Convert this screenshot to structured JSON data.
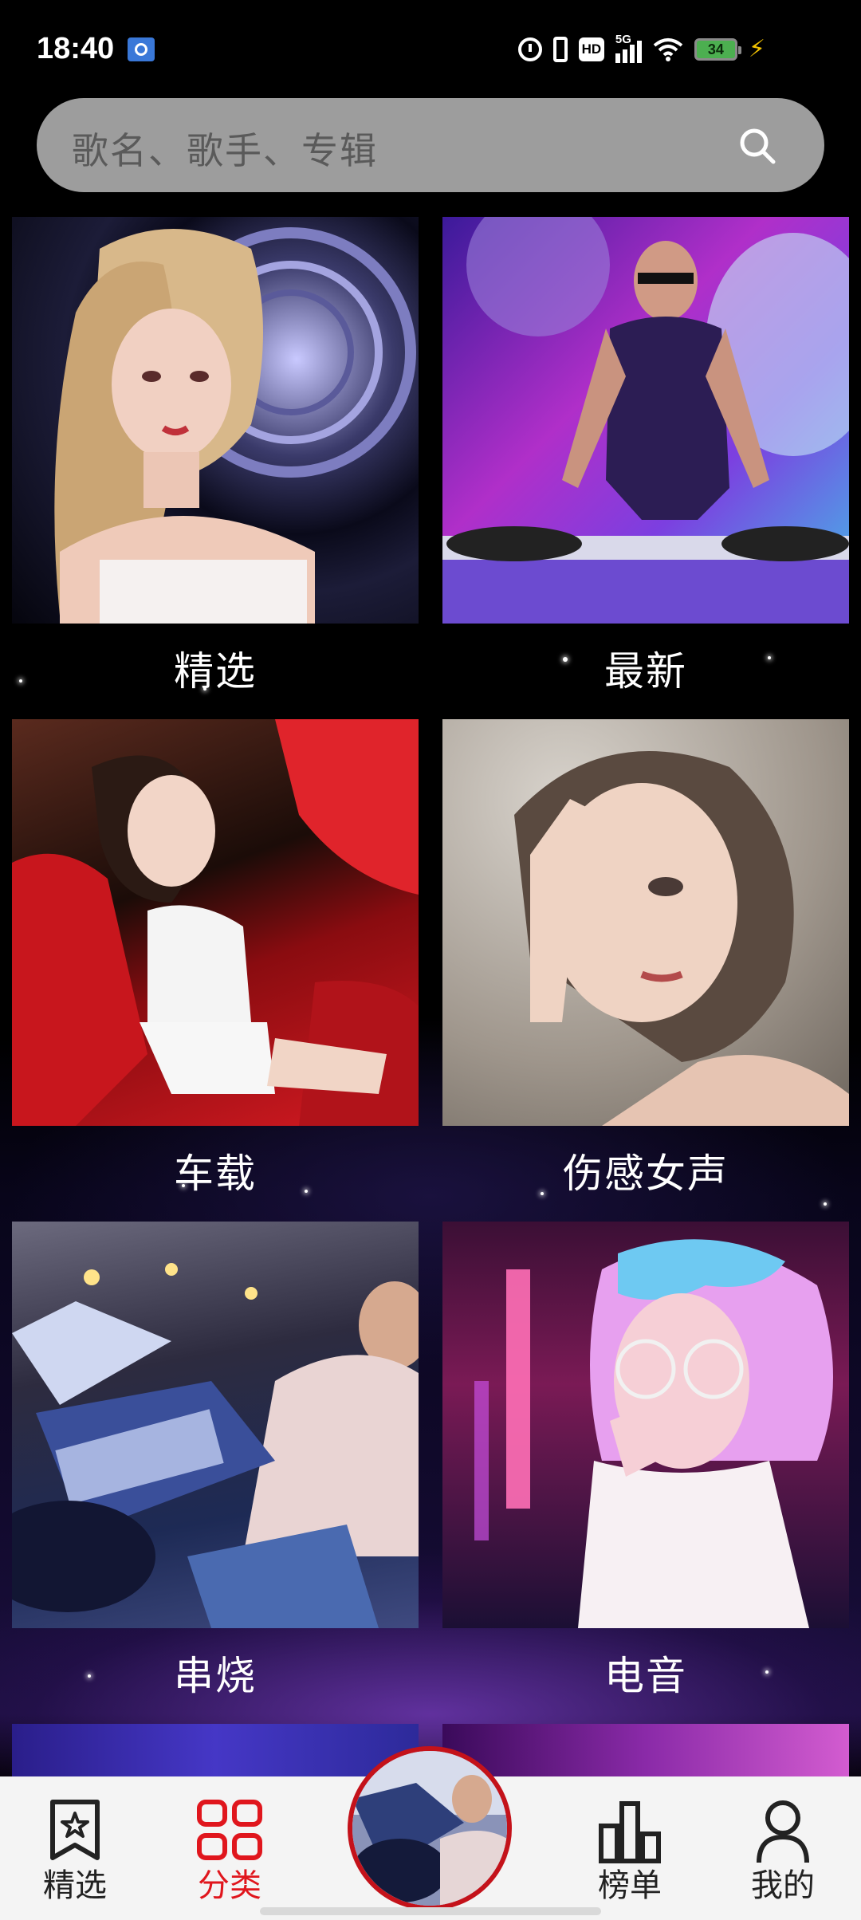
{
  "status_bar": {
    "time": "18:40",
    "network": "5G",
    "hd_label": "HD",
    "battery": "34"
  },
  "search": {
    "placeholder": "歌名、歌手、专辑"
  },
  "categories": [
    {
      "label": "精选",
      "image": "blonde-girl-portrait"
    },
    {
      "label": "最新",
      "image": "dj-woman-turntables"
    },
    {
      "label": "车载",
      "image": "woman-in-red-car"
    },
    {
      "label": "伤感女声",
      "image": "crying-girl-illustration"
    },
    {
      "label": "串烧",
      "image": "dj-at-mixer"
    },
    {
      "label": "电音",
      "image": "neon-girl-glasses"
    }
  ],
  "bottom_nav": {
    "items": [
      {
        "label": "精选",
        "icon": "star-bookmark-icon",
        "active": false
      },
      {
        "label": "分类",
        "icon": "grid-icon",
        "active": true
      },
      {
        "label": "榜单",
        "icon": "bar-chart-icon",
        "active": false
      },
      {
        "label": "我的",
        "icon": "person-icon",
        "active": false
      }
    ],
    "center": {
      "icon": "now-playing-disc"
    }
  },
  "colors": {
    "accent": "#e0161d",
    "search_bg": "#9d9d9d",
    "nav_bg": "#f4f4f4"
  }
}
